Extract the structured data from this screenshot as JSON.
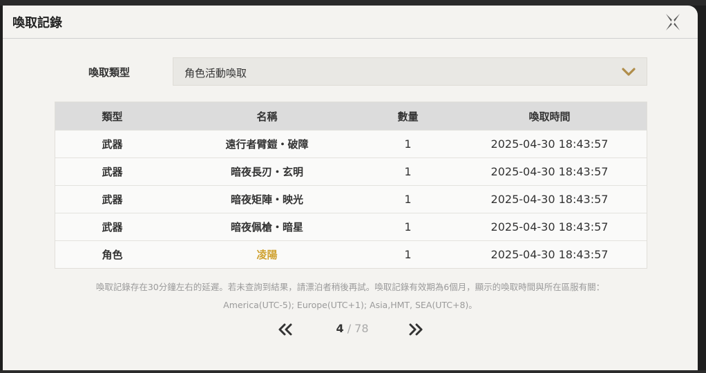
{
  "dialog": {
    "title": "喚取記錄"
  },
  "filter": {
    "label": "喚取類型",
    "selected": "角色活動喚取"
  },
  "table": {
    "headers": [
      "類型",
      "名稱",
      "數量",
      "喚取時間"
    ],
    "rows": [
      {
        "type": "武器",
        "name": "遠行者臂鎧・破障",
        "qty": "1",
        "time": "2025-04-30 18:43:57"
      },
      {
        "type": "武器",
        "name": "暗夜長刃・玄明",
        "qty": "1",
        "time": "2025-04-30 18:43:57"
      },
      {
        "type": "武器",
        "name": "暗夜矩陣・映光",
        "qty": "1",
        "time": "2025-04-30 18:43:57"
      },
      {
        "type": "武器",
        "name": "暗夜佩槍・暗星",
        "qty": "1",
        "time": "2025-04-30 18:43:57"
      },
      {
        "type": "角色",
        "name": "凌陽",
        "qty": "1",
        "time": "2025-04-30 18:43:57"
      }
    ]
  },
  "note": {
    "line1": "喚取記錄存在30分鐘左右的延遲。若未查詢到結果，請漂泊者稍後再試。喚取記錄有效期為6個月，顯示的喚取時間與所在區服有關：",
    "line2": "America(UTC-5); Europe(UTC+1); Asia,HMT, SEA(UTC+8)。"
  },
  "pager": {
    "current": "4",
    "separator": " / ",
    "total": "78"
  },
  "colors": {
    "gold": "#cfa12f",
    "chevron": "#b08d4a"
  },
  "icons": {
    "close": "close-icon",
    "dropdown": "chevron-down-icon",
    "prev": "double-chevron-left-icon",
    "next": "double-chevron-right-icon"
  }
}
